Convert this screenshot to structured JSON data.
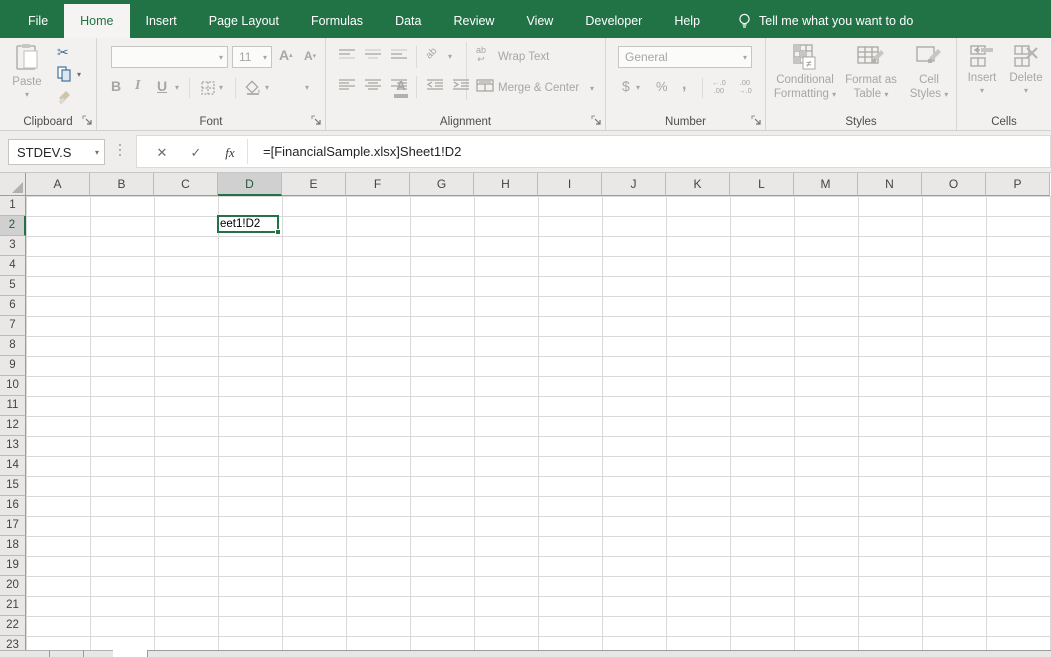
{
  "menu": {
    "tabs": [
      "File",
      "Home",
      "Insert",
      "Page Layout",
      "Formulas",
      "Data",
      "Review",
      "View",
      "Developer",
      "Help"
    ],
    "active_tab": "Home",
    "tell_me": "Tell me what you want to do"
  },
  "ribbon": {
    "clipboard": {
      "group_label": "Clipboard",
      "paste_label": "Paste"
    },
    "font": {
      "group_label": "Font",
      "font_name": "",
      "font_size": "11"
    },
    "alignment": {
      "group_label": "Alignment",
      "wrap_text_label": "Wrap Text",
      "merge_center_label": "Merge & Center"
    },
    "number": {
      "group_label": "Number",
      "format": "General",
      "dollar": "$",
      "percent": "%",
      "comma": ",",
      "inc_dec_top": "←.0",
      "inc_dec_bottom": ".00",
      "dec_dec_top": ".00",
      "dec_dec_bottom": "→.0"
    },
    "styles": {
      "group_label": "Styles",
      "conditional_formatting": "Conditional Formatting",
      "format_as_table": "Format as Table",
      "cell_styles": "Cell Styles"
    },
    "cells": {
      "group_label": "Cells",
      "insert_label": "Insert",
      "delete_label": "Delete"
    }
  },
  "formula_bar": {
    "name_box": "STDEV.S",
    "formula": "=[FinancialSample.xlsx]Sheet1!D2"
  },
  "grid": {
    "columns": [
      "A",
      "B",
      "C",
      "D",
      "E",
      "F",
      "G",
      "H",
      "I",
      "J",
      "K",
      "L",
      "M",
      "N",
      "O",
      "P"
    ],
    "rows": [
      "1",
      "2",
      "3",
      "4",
      "5",
      "6",
      "7",
      "8",
      "9",
      "10",
      "11",
      "12",
      "13",
      "14",
      "15",
      "16",
      "17",
      "18",
      "19",
      "20",
      "21",
      "22",
      "23"
    ],
    "active_cell": {
      "col": "D",
      "row": "2",
      "text": "eet1!D2"
    }
  },
  "icons": {
    "dropdown": "▾",
    "cut": "✂",
    "cancel": "✕",
    "enter": "✓",
    "fx": "fx",
    "bold": "B",
    "italic": "I",
    "underline": "U",
    "font_color_letter": "A",
    "grow_font_letter": "A",
    "shrink_font_letter": "A",
    "caret_up": "▴",
    "caret_down": "▾",
    "ab": "ab"
  },
  "colors": {
    "accent_green": "#217346",
    "disabled_gray": "#a8a6a3",
    "cut_copy_blue": "#41719c"
  }
}
